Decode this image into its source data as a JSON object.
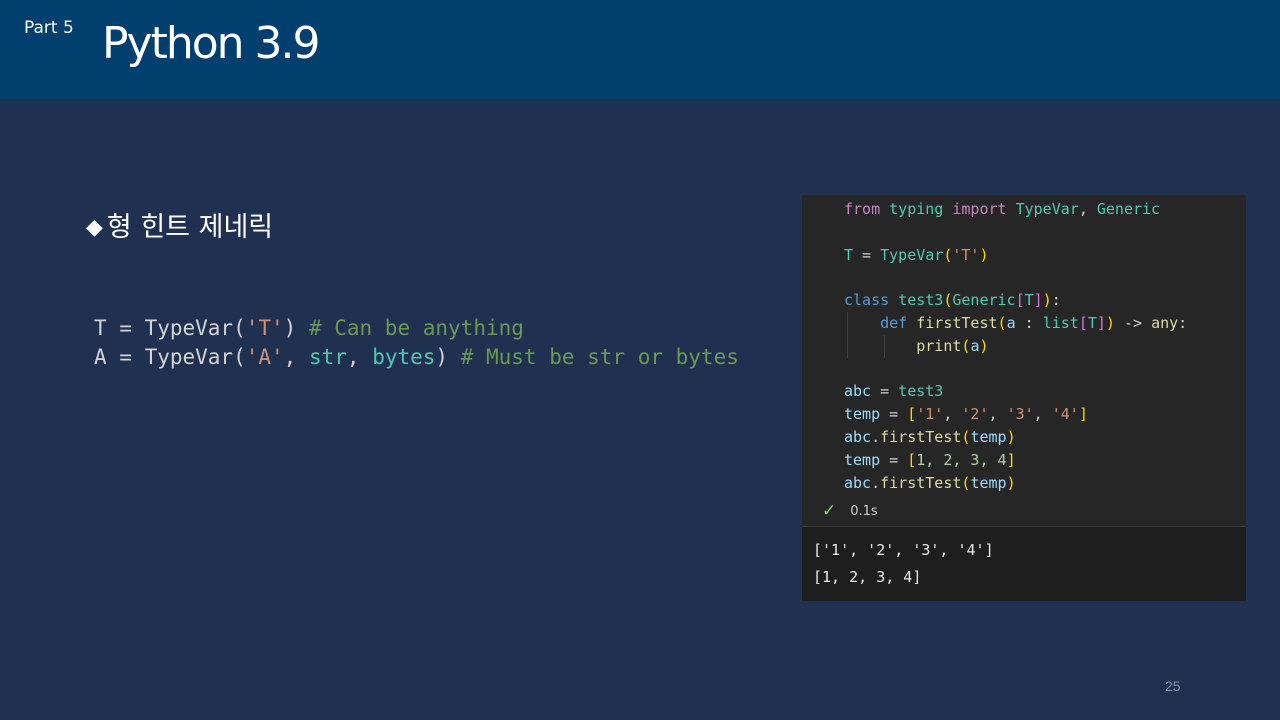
{
  "header": {
    "part_label": "Part 5",
    "title": "Python 3.9"
  },
  "section": {
    "bullet": "◆",
    "heading": "형 힌트 제네릭"
  },
  "left_code": {
    "line1": {
      "a": "T = TypeVar(",
      "str": "'T'",
      "b": ") ",
      "comment": "# Can be anything"
    },
    "line2": {
      "a": "A = TypeVar(",
      "str": "'A'",
      "b": ", ",
      "t1": "str",
      "c": ", ",
      "t2": "bytes",
      "d": ") ",
      "comment": "# Must be str or bytes"
    }
  },
  "notebook": {
    "code": {
      "l1_from": "from",
      "l1_mod": "typing",
      "l1_import": "import",
      "l1_n1": "TypeVar",
      "l1_comma": ", ",
      "l1_n2": "Generic",
      "l3_t": "T",
      "l3_eq": " = ",
      "l3_fn": "TypeVar",
      "l3_p1": "(",
      "l3_str": "'T'",
      "l3_p2": ")",
      "l5_class": "class",
      "l5_name": "test3",
      "l5_p1": "(",
      "l5_base": "Generic",
      "l5_b1": "[",
      "l5_t": "T",
      "l5_b2": "]",
      "l5_p2": ")",
      "l5_colon": ":",
      "l6_def": "def",
      "l6_fn": "firstTest",
      "l6_p1": "(",
      "l6_a": "a",
      "l6_sep": " : ",
      "l6_list": "list",
      "l6_b1": "[",
      "l6_t": "T",
      "l6_b2": "]",
      "l6_p2": ")",
      "l6_arrow": " -> ",
      "l6_any": "any",
      "l6_colon": ":",
      "l7_print": "print",
      "l7_p1": "(",
      "l7_a": "a",
      "l7_p2": ")",
      "l9_abc": "abc",
      "l9_eq": " = ",
      "l9_cls": "test3",
      "l10_temp": "temp",
      "l10_eq": " = ",
      "l10_b1": "[",
      "l10_s1": "'1'",
      "l10_s2": "'2'",
      "l10_s3": "'3'",
      "l10_s4": "'4'",
      "l10_b2": "]",
      "l11_abc": "abc",
      "l11_dot": ".",
      "l11_fn": "firstTest",
      "l11_p1": "(",
      "l11_arg": "temp",
      "l11_p2": ")",
      "l12_temp": "temp",
      "l12_eq": " = ",
      "l12_b1": "[",
      "l12_nums": "1, 2, 3, 4",
      "l12_b2": "]",
      "l13_abc": "abc",
      "l13_dot": ".",
      "l13_fn": "firstTest",
      "l13_p1": "(",
      "l13_arg": "temp",
      "l13_p2": ")",
      "comma": ", "
    },
    "status": {
      "icon": "check-icon",
      "check_glyph": "✓",
      "time": "0.1s"
    },
    "output": {
      "line1": "['1', '2', '3', '4']",
      "line2": "[1, 2, 3, 4]"
    }
  },
  "page_number": "25",
  "colors": {
    "header_bg": "#003f6e",
    "slide_bg": "#1f3050",
    "notebook_bg": "#1e1e1e"
  }
}
